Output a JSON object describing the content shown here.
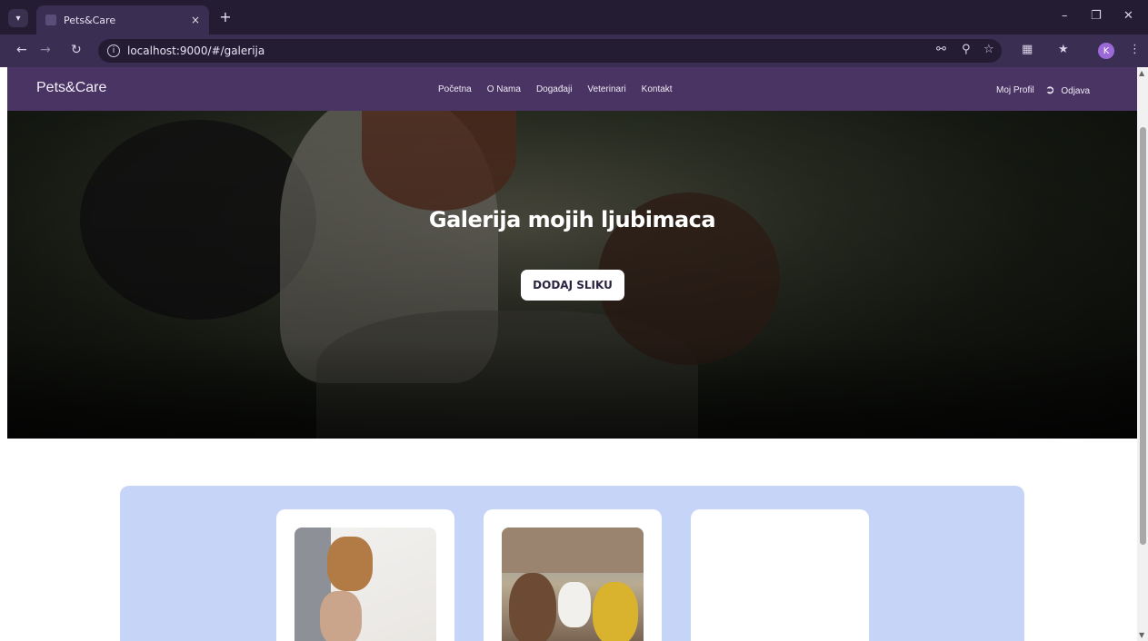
{
  "browser": {
    "tab_title": "Pets&Care",
    "tab_close": "×",
    "new_tab": "+",
    "url": "localhost:9000/#/galerija",
    "profile_initial": "K"
  },
  "site": {
    "brand": "Pets&Care",
    "nav_links": [
      "Početna",
      "O Nama",
      "Događaji",
      "Veterinari",
      "Kontakt"
    ],
    "profile_link": "Moj Profil",
    "logout_link": "Odjava"
  },
  "hero": {
    "title": "Galerija mojih ljubimaca",
    "button_label": "DODAJ SLIKU"
  },
  "colors": {
    "nav_bg": "#4a3463",
    "gallery_bg": "#c6d5f7"
  }
}
